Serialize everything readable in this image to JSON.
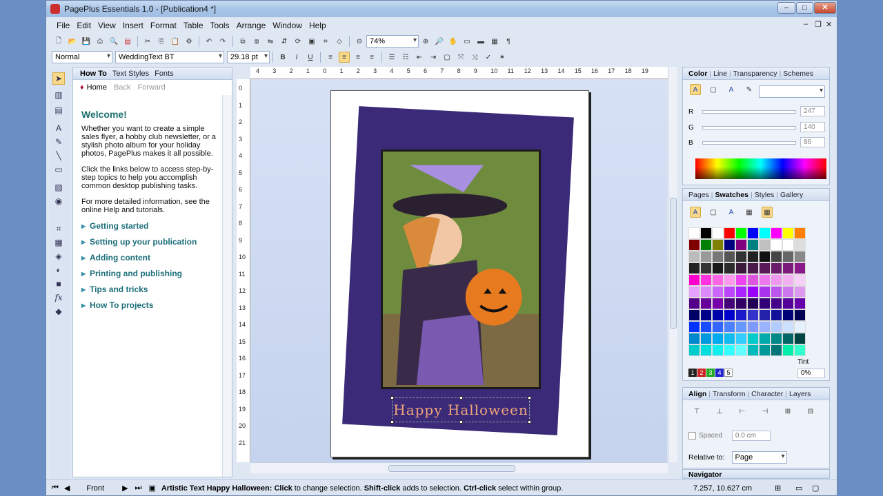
{
  "window": {
    "title": "PagePlus Essentials 1.0 - [Publication4 *]"
  },
  "menu": [
    "File",
    "Edit",
    "View",
    "Insert",
    "Format",
    "Table",
    "Tools",
    "Arrange",
    "Window",
    "Help"
  ],
  "toolbar": {
    "zoom": "74%"
  },
  "format": {
    "style": "Normal",
    "font": "WeddingText BT",
    "size": "29.18 pt",
    "bold": "B",
    "italic": "I",
    "underline": "U"
  },
  "howto": {
    "tabs": [
      "How To",
      "Text Styles",
      "Fonts"
    ],
    "nav": {
      "home": "Home",
      "back": "Back",
      "forward": "Forward"
    },
    "heading": "Welcome!",
    "paragraphs": [
      "Whether you want to create a simple sales flyer, a hobby club newsletter, or a stylish photo album for your holiday photos, PagePlus makes it all possible.",
      "Click the links below to access step-by-step topics to help you accomplish common desktop publishing tasks.",
      "For more detailed information, see the online Help and tutorials."
    ],
    "links": [
      "Getting started",
      "Setting up your publication",
      "Adding content",
      "Printing and publishing",
      "Tips and tricks",
      "How To projects"
    ]
  },
  "ruler": {
    "h": [
      "4",
      "3",
      "2",
      "1",
      "0",
      "1",
      "2",
      "3",
      "4",
      "5",
      "6",
      "7",
      "8",
      "9",
      "10",
      "11",
      "12",
      "13",
      "14",
      "15",
      "16",
      "17",
      "18",
      "19"
    ],
    "v": [
      "0",
      "1",
      "2",
      "3",
      "4",
      "5",
      "6",
      "7",
      "8",
      "9",
      "10",
      "11",
      "12",
      "13",
      "14",
      "15",
      "16",
      "17",
      "18",
      "19",
      "20",
      "21"
    ]
  },
  "canvas": {
    "artistic_text": "Happy Halloween"
  },
  "color_panel": {
    "tabs": [
      "Color",
      "Line",
      "Transparency",
      "Schemes"
    ],
    "rgb": [
      {
        "label": "R",
        "value": "247"
      },
      {
        "label": "G",
        "value": "140"
      },
      {
        "label": "B",
        "value": "86"
      }
    ]
  },
  "swatch_panel": {
    "tabs": [
      "Pages",
      "Swatches",
      "Styles",
      "Gallery"
    ],
    "tint_label": "Tint",
    "tint_value": "0%",
    "colors": [
      "#ffffff",
      "#000000",
      "#ffffff",
      "#ff0000",
      "#00ff00",
      "#0000ff",
      "#00ffff",
      "#ff00ff",
      "#ffff00",
      "#ff8000",
      "#800000",
      "#008000",
      "#808000",
      "#000080",
      "#800080",
      "#008080",
      "#c0c0c0",
      "#ffffff",
      "#ffffff",
      "#dddddd",
      "#bbbbbb",
      "#999999",
      "#777777",
      "#555555",
      "#333333",
      "#222222",
      "#111111",
      "#444444",
      "#666666",
      "#888888",
      "#222222",
      "#333333",
      "#1a1a1a",
      "#2b2b2b",
      "#3a1a3a",
      "#4a1a4a",
      "#5a1a5a",
      "#6a1a6a",
      "#7a1a7a",
      "#8a1a8a",
      "#ff00cc",
      "#ff33dd",
      "#ff66e5",
      "#ff99ee",
      "#ee44ee",
      "#dd55dd",
      "#ee77ee",
      "#ee99ee",
      "#f2b0f2",
      "#f7d0f7",
      "#e8a0ff",
      "#dd88ff",
      "#cc66ff",
      "#bb44ff",
      "#aa22ff",
      "#9900ff",
      "#aa33ee",
      "#bb55ee",
      "#cc77ee",
      "#dd99ee",
      "#550088",
      "#660099",
      "#7700aa",
      "#440077",
      "#330066",
      "#220055",
      "#330077",
      "#440088",
      "#550099",
      "#6600aa",
      "#000066",
      "#000088",
      "#0000aa",
      "#0000cc",
      "#1a1acc",
      "#3333cc",
      "#2222aa",
      "#111199",
      "#000077",
      "#000055",
      "#0033ff",
      "#1a4dff",
      "#3366ff",
      "#4d80ff",
      "#6699ff",
      "#8099ff",
      "#99b3ff",
      "#b3ccff",
      "#cce0ff",
      "#e6f0ff",
      "#0088cc",
      "#0099dd",
      "#00aaee",
      "#11bbee",
      "#33ccff",
      "#00cccc",
      "#00aaaa",
      "#008888",
      "#006666",
      "#004444",
      "#00cccc",
      "#00dddd",
      "#11eeee",
      "#33ffff",
      "#66ffff",
      "#00bbbb",
      "#009999",
      "#007777",
      "#00eeaa",
      "#33ffcc"
    ],
    "palette_numbers": [
      "1",
      "2",
      "3",
      "4",
      "5"
    ]
  },
  "align_panel": {
    "tabs": [
      "Align",
      "Transform",
      "Character",
      "Layers"
    ],
    "spaced_label": "Spaced",
    "spacing_value": "0.0 cm",
    "relative_label": "Relative to:",
    "relative_value": "Page"
  },
  "navigator_label": "Navigator",
  "status": {
    "page": "Front",
    "message_bold": "Artistic Text Happy Halloween: Click",
    "message_1": " to change selection. ",
    "shift": "Shift-click",
    "message_2": " adds to selection. ",
    "ctrl": "Ctrl-click",
    "message_3": " select within group.",
    "coords": "7.257, 10.627 cm"
  }
}
